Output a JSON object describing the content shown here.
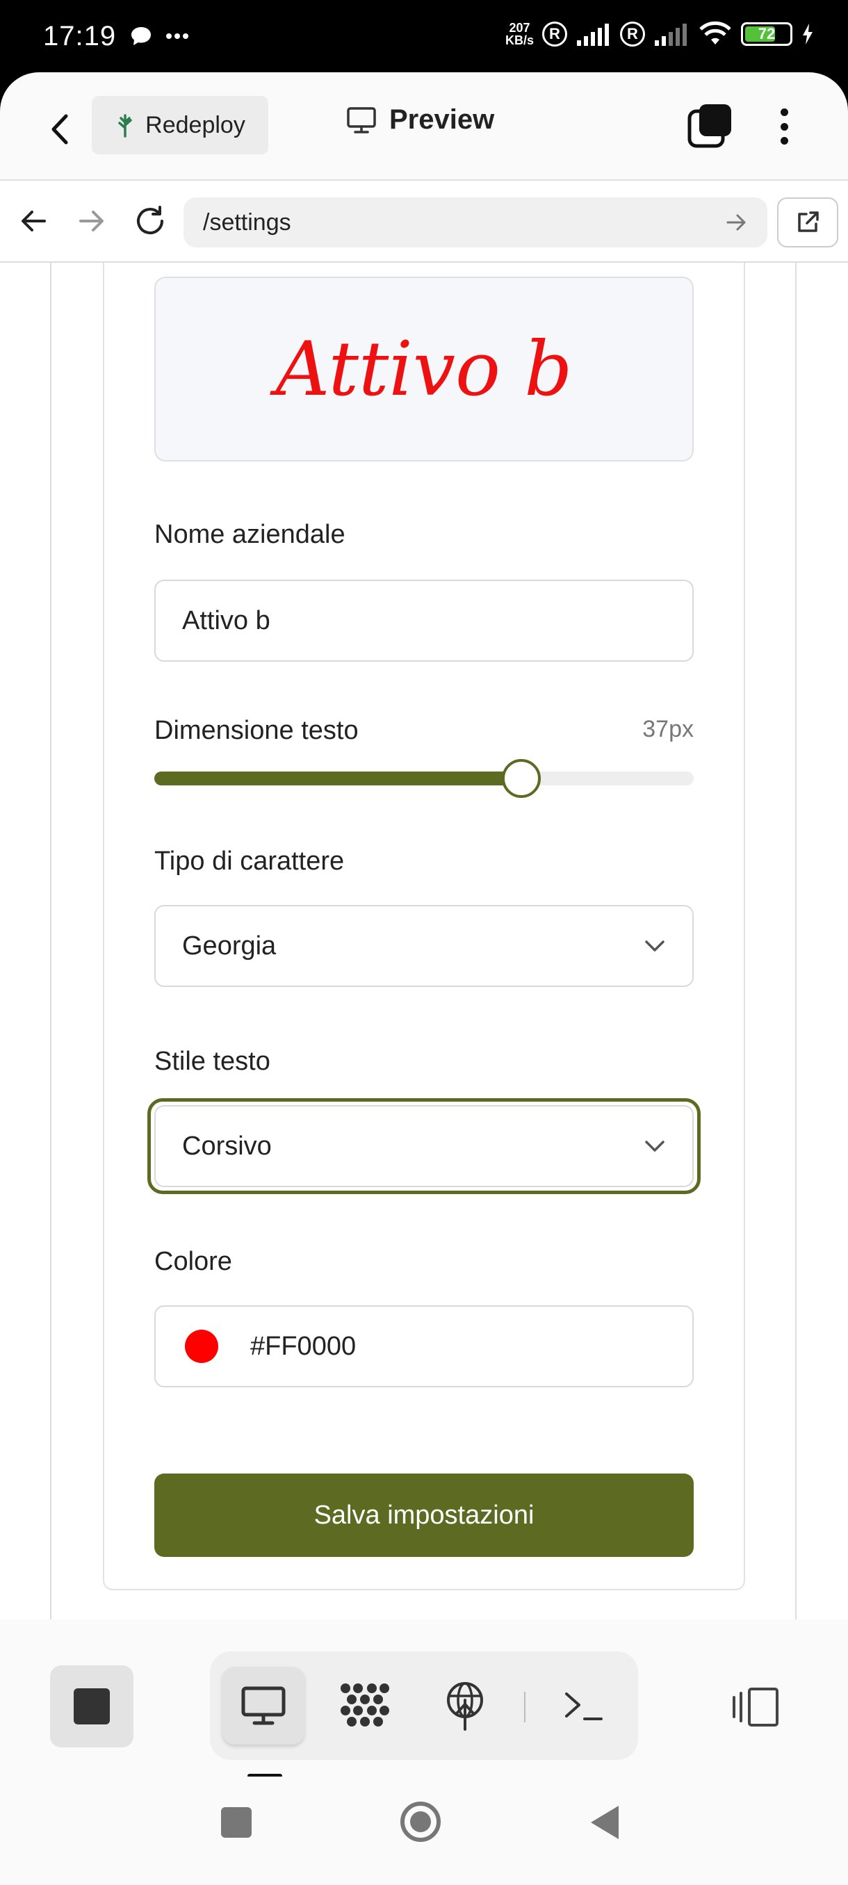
{
  "status_bar": {
    "time": "17:19",
    "net_speed_value": "207",
    "net_speed_unit": "KB/s",
    "sim_label": "R",
    "battery": "72",
    "battery_level": 0.72
  },
  "header": {
    "redeploy_label": "Redeploy",
    "title": "Preview"
  },
  "url_bar": {
    "url": "/settings"
  },
  "preview": {
    "text": "Attivo b",
    "color": "#FF0000"
  },
  "form": {
    "company_name_label": "Nome aziendale",
    "company_name_value": "Attivo b",
    "text_size_label": "Dimensione testo",
    "text_size_value": "37px",
    "text_size_level": 0.68,
    "font_type_label": "Tipo di carattere",
    "font_type_value": "Georgia",
    "text_style_label": "Stile testo",
    "text_style_value": "Corsivo",
    "color_label": "Colore",
    "color_value": "#FF0000",
    "save_label": "Salva impostazioni"
  },
  "colors": {
    "accent": "#5D6A22",
    "preview_text": "#EE1111"
  },
  "toolbar": {
    "items": [
      "stop-icon",
      "monitor-icon",
      "grid-icon",
      "network-icon",
      "terminal-icon",
      "layout-icon"
    ]
  }
}
